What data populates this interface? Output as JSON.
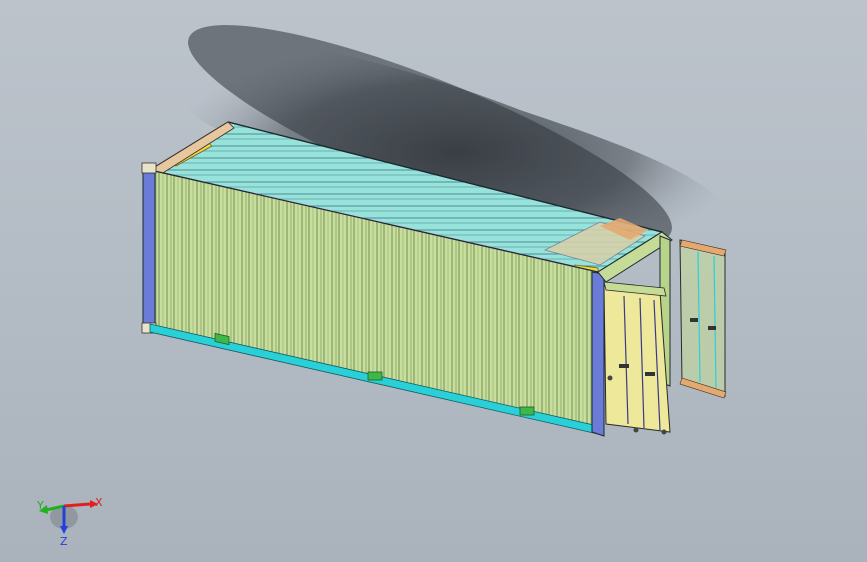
{
  "triad": {
    "x_label": "X",
    "y_label": "Y",
    "z_label": "Z",
    "x_color": "#e02020",
    "y_color": "#20b020",
    "z_color": "#2040e0"
  },
  "colors": {
    "background": "#b8c0c8",
    "side_panel": "#c5dc98",
    "roof_panel": "#8fe0dc",
    "frame_edge": "#6a7cd8",
    "bottom_rail": "#2ad0d8",
    "roof_edge": "#c050c0",
    "door_fill": "#eee89a",
    "corner_post": "#f0d840"
  }
}
